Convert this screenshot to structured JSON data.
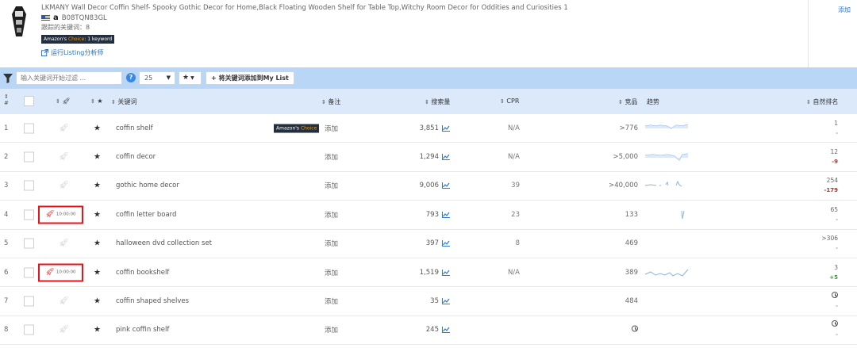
{
  "product": {
    "title": "LKMANY Wall Decor Coffin Shelf- Spooky Gothic Decor for Home,Black Floating Wooden Shelf for Table Top,Witchy Room Decor for Oddities and Curiosities 1",
    "marketplace_letter": "a",
    "asin": "B08TQN83GL",
    "tracked_keywords": "跟踪的关键词：8",
    "choice_prefix": "Amazon's ",
    "choice_word": "Choice",
    "choice_suffix": ": 1 keyword",
    "run_listing": "运行Listing分析师",
    "add_top": "添加"
  },
  "toolbar": {
    "search_placeholder": "输入关键词开始过滤 ...",
    "per_page": "25",
    "add_to_list": "将关键词添加到My List"
  },
  "columns": {
    "num": "#",
    "keyword": "关键词",
    "notes": "备注",
    "volume": "搜索量",
    "cpr": "CPR",
    "products": "竞品",
    "trend": "趋势",
    "organic_rank": "自然排名"
  },
  "rows": [
    {
      "idx": "1",
      "keyword": "coffin shelf",
      "badge": true,
      "add": "添加",
      "volume": "3,851",
      "cpr": "N/A",
      "products": ">776",
      "rank": "1",
      "delta": "-",
      "delta_class": "mut",
      "boxed": false,
      "trend": "wave1"
    },
    {
      "idx": "2",
      "keyword": "coffin decor",
      "badge": false,
      "add": "添加",
      "volume": "1,294",
      "cpr": "N/A",
      "products": ">5,000",
      "rank": "12",
      "delta": "-9",
      "delta_class": "neg",
      "boxed": false,
      "trend": "wave2"
    },
    {
      "idx": "3",
      "keyword": "gothic home decor",
      "badge": false,
      "add": "添加",
      "volume": "9,006",
      "cpr": "39",
      "products": ">40,000",
      "rank": "254",
      "delta": "-179",
      "delta_class": "neg",
      "boxed": false,
      "trend": "sparse"
    },
    {
      "idx": "4",
      "keyword": "coffin letter board",
      "badge": false,
      "add": "添加",
      "volume": "793",
      "cpr": "23",
      "products": "133",
      "rank": "65",
      "delta": "-",
      "delta_class": "mut",
      "boxed": true,
      "boxtext": "10:00:00",
      "trend": "spike"
    },
    {
      "idx": "5",
      "keyword": "halloween dvd collection set",
      "badge": false,
      "add": "添加",
      "volume": "397",
      "cpr": "8",
      "products": "469",
      "rank": ">306",
      "delta": "-",
      "delta_class": "mut",
      "boxed": false,
      "trend": "none"
    },
    {
      "idx": "6",
      "keyword": "coffin bookshelf",
      "badge": false,
      "add": "添加",
      "volume": "1,519",
      "cpr": "N/A",
      "products": "389",
      "rank": "3",
      "delta": "+5",
      "delta_class": "pos",
      "boxed": true,
      "boxtext": "10:00:00",
      "trend": "wave3"
    },
    {
      "idx": "7",
      "keyword": "coffin shaped shelves",
      "badge": false,
      "add": "添加",
      "volume": "35",
      "cpr": "",
      "products": "484",
      "rank": "",
      "delta": "-",
      "delta_class": "mut",
      "boxed": false,
      "trend": "none",
      "rank_clock": true
    },
    {
      "idx": "8",
      "keyword": "pink coffin shelf",
      "badge": false,
      "add": "添加",
      "volume": "245",
      "cpr": "",
      "products": "",
      "rank": "",
      "delta": "-",
      "delta_class": "mut",
      "boxed": false,
      "trend": "none",
      "rank_clock": true,
      "products_clock": true
    }
  ],
  "colors": {
    "toolbar": "#b9d6f7",
    "header_row": "#dce9fb",
    "highlight": "#e8131b",
    "link": "#1a6fc9"
  }
}
